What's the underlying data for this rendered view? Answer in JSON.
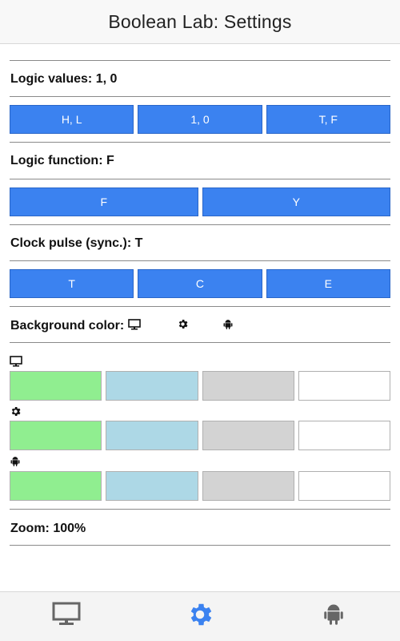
{
  "header": {
    "title": "Boolean Lab: Settings"
  },
  "logic_values": {
    "label": "Logic values: 1, 0",
    "options": [
      "H, L",
      "1, 0",
      "T, F"
    ]
  },
  "logic_function": {
    "label": "Logic function: F",
    "options": [
      "F",
      "Y"
    ]
  },
  "clock_pulse": {
    "label": "Clock pulse (sync.): T",
    "options": [
      "T",
      "C",
      "E"
    ]
  },
  "background_color": {
    "label": "Background color:",
    "header_icons": [
      "monitor-icon",
      "gear-icon",
      "android-icon"
    ],
    "rows": [
      {
        "icon": "monitor-icon",
        "swatches": [
          "#90ee90",
          "#add8e6",
          "#d3d3d3",
          "#ffffff"
        ]
      },
      {
        "icon": "gear-icon",
        "swatches": [
          "#90ee90",
          "#add8e6",
          "#d3d3d3",
          "#ffffff"
        ]
      },
      {
        "icon": "android-icon",
        "swatches": [
          "#90ee90",
          "#add8e6",
          "#d3d3d3",
          "#ffffff"
        ]
      }
    ]
  },
  "zoom": {
    "label": "Zoom: 100%"
  },
  "footer": {
    "tabs": [
      "monitor-icon",
      "gear-icon",
      "android-icon"
    ],
    "active_tab": "gear-icon",
    "active_color": "#3b82f0",
    "inactive_color": "#666666"
  },
  "colors": {
    "button_blue": "#3b82f0"
  }
}
